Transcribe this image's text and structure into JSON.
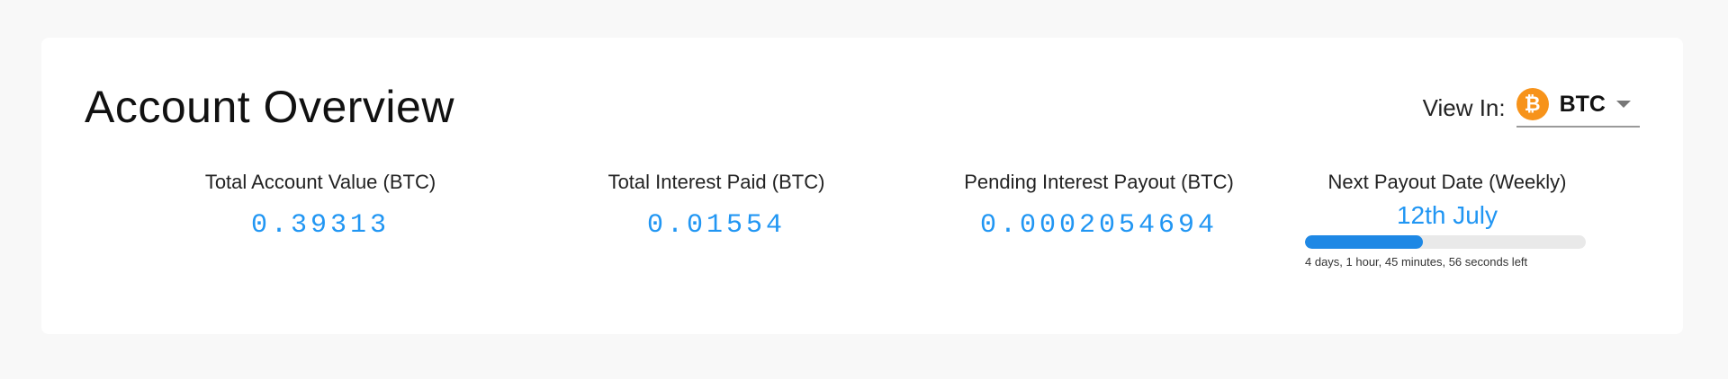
{
  "header": {
    "title": "Account Overview",
    "view_in_label": "View In:",
    "currency": {
      "icon": "bitcoin-icon",
      "icon_glyph": "₿",
      "code": "BTC",
      "color": "#f7931a"
    }
  },
  "stats": [
    {
      "label": "Total Account Value (BTC)",
      "value": "0.39313"
    },
    {
      "label": "Total Interest Paid (BTC)",
      "value": "0.01554"
    },
    {
      "label": "Pending Interest Payout (BTC)",
      "value": "0.0002054694"
    }
  ],
  "payout": {
    "label": "Next Payout Date (Weekly)",
    "date": "12th July",
    "progress": 0.42,
    "countdown": "4 days, 1 hour, 45 minutes, 56 seconds left"
  },
  "colors": {
    "accent": "#2196f3",
    "progress_fill": "#1e88e5",
    "progress_track": "#e9e9e9"
  }
}
